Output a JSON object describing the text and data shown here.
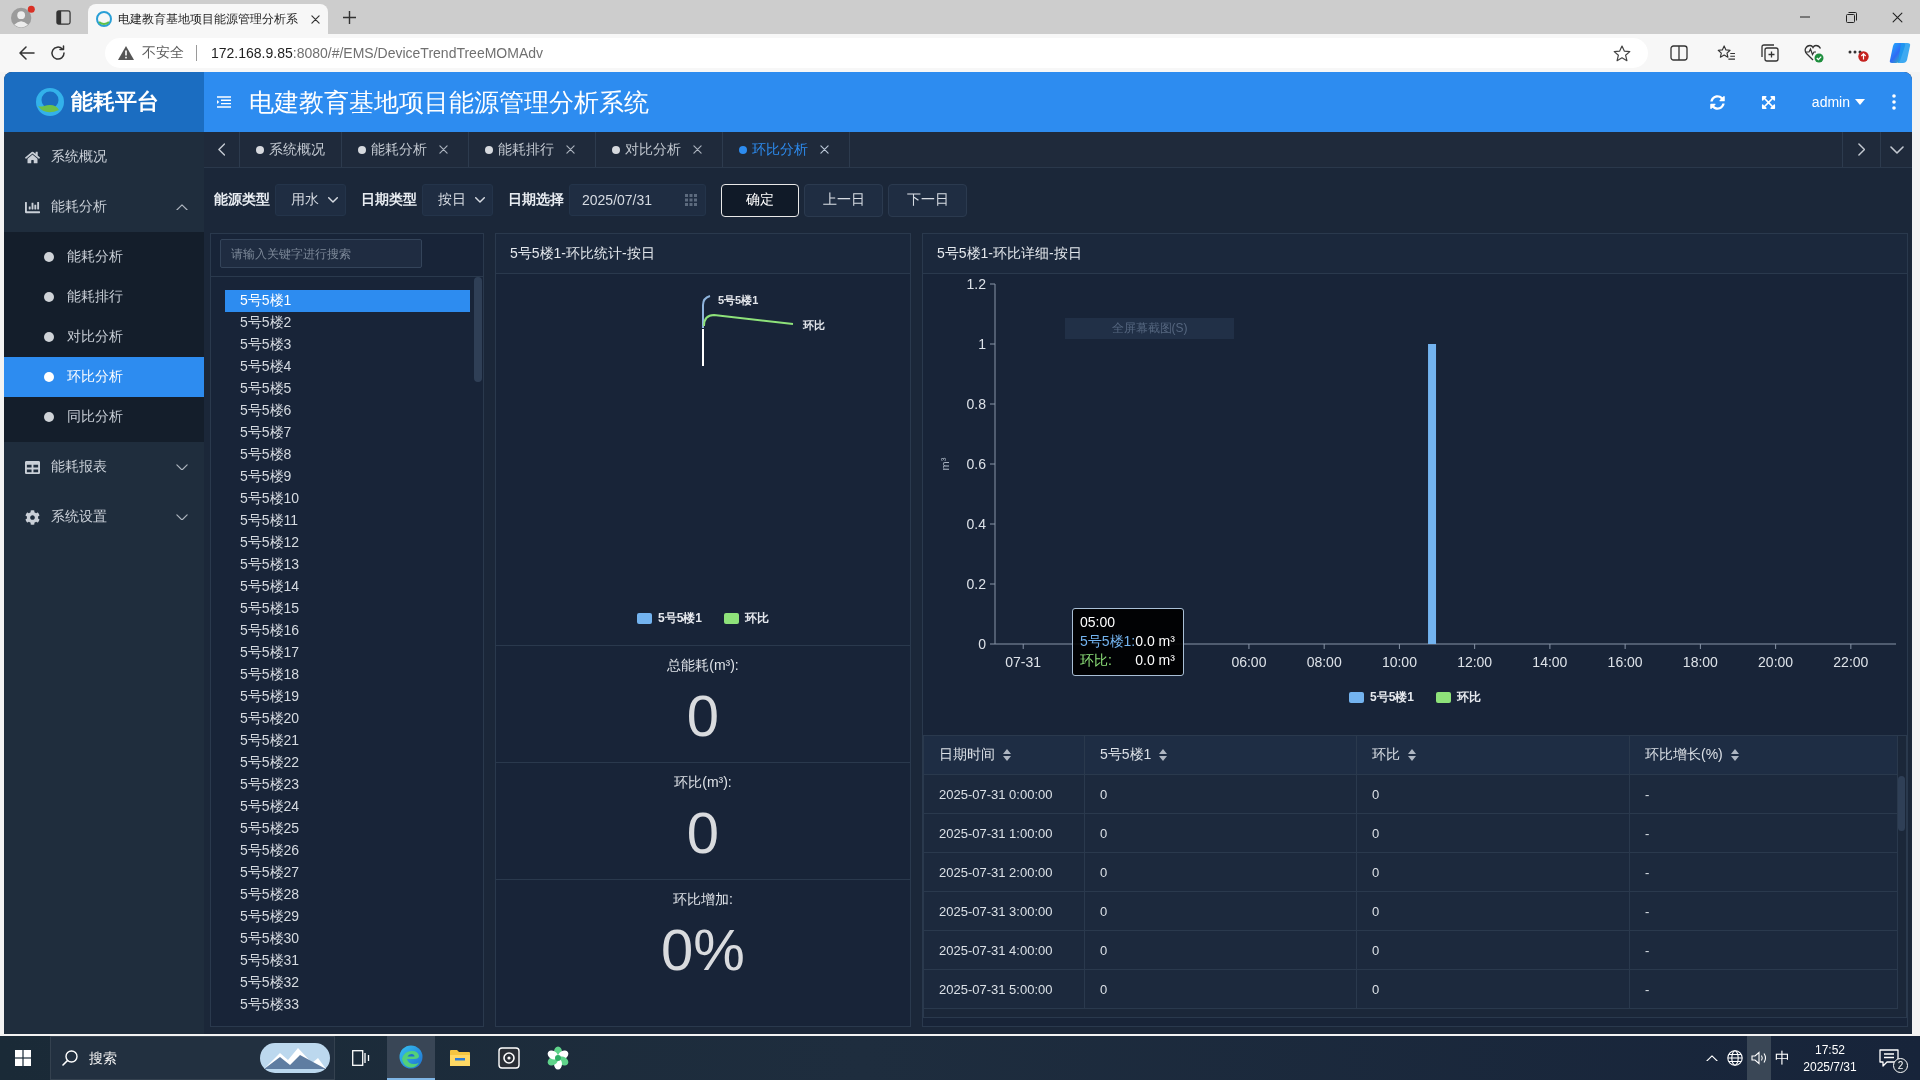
{
  "browser": {
    "tab": {
      "title": "电建教育基地项目能源管理分析系"
    },
    "address": {
      "security": "不安全",
      "host": "172.168.9.85",
      "path": ":8080/#/EMS/DeviceTrendTreeMOMAdv"
    }
  },
  "header": {
    "logo": "能耗平台",
    "title": "电建教育基地项目能源管理分析系统",
    "user": "admin"
  },
  "sidebar": {
    "items": [
      {
        "label": "系统概况",
        "kind": "link",
        "selected": false
      },
      {
        "label": "能耗分析",
        "kind": "group",
        "expanded": true,
        "children": [
          {
            "label": "能耗分析",
            "selected": false
          },
          {
            "label": "能耗排行",
            "selected": false
          },
          {
            "label": "对比分析",
            "selected": false
          },
          {
            "label": "环比分析",
            "selected": true
          },
          {
            "label": "同比分析",
            "selected": false
          }
        ]
      },
      {
        "label": "能耗报表",
        "kind": "group",
        "expanded": false
      },
      {
        "label": "系统设置",
        "kind": "group",
        "expanded": false
      }
    ]
  },
  "tabs": [
    {
      "label": "系统概况",
      "closable": false,
      "selected": false
    },
    {
      "label": "能耗分析",
      "closable": true,
      "selected": false
    },
    {
      "label": "能耗排行",
      "closable": true,
      "selected": false
    },
    {
      "label": "对比分析",
      "closable": true,
      "selected": false
    },
    {
      "label": "环比分析",
      "closable": true,
      "selected": true
    }
  ],
  "filters": [
    {
      "kind": "select",
      "label": "能源类型",
      "value": "用水"
    },
    {
      "kind": "select",
      "label": "日期类型",
      "value": "按日"
    },
    {
      "kind": "date",
      "label": "日期选择",
      "value": "2025/07/31"
    }
  ],
  "actions": [
    {
      "label": "确定",
      "kind": "primary"
    },
    {
      "label": "上一日",
      "kind": "default"
    },
    {
      "label": "下一日",
      "kind": "default"
    }
  ],
  "device_tree": {
    "search": {
      "placeholder": "请输入关键字进行搜索"
    },
    "items": [
      {
        "label": "5号5楼1",
        "selected": true
      },
      {
        "label": "5号5楼2",
        "selected": false
      },
      {
        "label": "5号5楼3",
        "selected": false
      },
      {
        "label": "5号5楼4",
        "selected": false
      },
      {
        "label": "5号5楼5",
        "selected": false
      },
      {
        "label": "5号5楼6",
        "selected": false
      },
      {
        "label": "5号5楼7",
        "selected": false
      },
      {
        "label": "5号5楼8",
        "selected": false
      },
      {
        "label": "5号5楼9",
        "selected": false
      },
      {
        "label": "5号5楼10",
        "selected": false
      },
      {
        "label": "5号5楼11",
        "selected": false
      },
      {
        "label": "5号5楼12",
        "selected": false
      },
      {
        "label": "5号5楼13",
        "selected": false
      },
      {
        "label": "5号5楼14",
        "selected": false
      },
      {
        "label": "5号5楼15",
        "selected": false
      },
      {
        "label": "5号5楼16",
        "selected": false
      },
      {
        "label": "5号5楼17",
        "selected": false
      },
      {
        "label": "5号5楼18",
        "selected": false
      },
      {
        "label": "5号5楼19",
        "selected": false
      },
      {
        "label": "5号5楼20",
        "selected": false
      },
      {
        "label": "5号5楼21",
        "selected": false
      },
      {
        "label": "5号5楼22",
        "selected": false
      },
      {
        "label": "5号5楼23",
        "selected": false
      },
      {
        "label": "5号5楼24",
        "selected": false
      },
      {
        "label": "5号5楼25",
        "selected": false
      },
      {
        "label": "5号5楼26",
        "selected": false
      },
      {
        "label": "5号5楼27",
        "selected": false
      },
      {
        "label": "5号5楼28",
        "selected": false
      },
      {
        "label": "5号5楼29",
        "selected": false
      },
      {
        "label": "5号5楼30",
        "selected": false
      },
      {
        "label": "5号5楼31",
        "selected": false
      },
      {
        "label": "5号5楼32",
        "selected": false
      },
      {
        "label": "5号5楼33",
        "selected": false
      }
    ]
  },
  "summary_panel": {
    "title": "5号5楼1-环比统计-按日",
    "pie_labels": [
      {
        "text": "5号5楼1",
        "color": "#8fb4dc"
      },
      {
        "text": "环比",
        "color": "#8ee27a"
      }
    ],
    "legend": [
      {
        "label": "5号5楼1",
        "color": "#73b3ef"
      },
      {
        "label": "环比",
        "color": "#8ee27a"
      }
    ],
    "stats": [
      {
        "label": "总能耗(m³):",
        "value": "0"
      },
      {
        "label": "环比(m³):",
        "value": "0"
      },
      {
        "label": "环比增加:",
        "value": "0%"
      }
    ]
  },
  "detail_panel": {
    "title": "5号5楼1-环比详细-按日",
    "screen_tip": "全屏幕截图(S)",
    "chart_data": {
      "type": "bar",
      "ylabel": "m³",
      "x": [
        11
      ],
      "series": [
        {
          "name": "5号5楼1",
          "color": "#73b3ef",
          "values": [
            1
          ]
        },
        {
          "name": "环比",
          "color": "#8ee27a",
          "values": [
            0
          ]
        }
      ],
      "xlim": [
        -0.75,
        23.2
      ],
      "ylim": [
        0,
        1.2
      ],
      "yticks": [
        0,
        0.2,
        0.4,
        0.6,
        0.8,
        1,
        1.2
      ],
      "xticks": [
        {
          "value": 0,
          "label": "07-31"
        },
        {
          "value": 6,
          "label": "06:00"
        },
        {
          "value": 8,
          "label": "08:00"
        },
        {
          "value": 10,
          "label": "10:00"
        },
        {
          "value": 12,
          "label": "12:00"
        },
        {
          "value": 14,
          "label": "14:00"
        },
        {
          "value": 16,
          "label": "16:00"
        },
        {
          "value": 18,
          "label": "18:00"
        },
        {
          "value": 20,
          "label": "20:00"
        },
        {
          "value": 22,
          "label": "22:00"
        }
      ]
    },
    "tooltip": {
      "title": "05:00",
      "rows": [
        {
          "label": "5号5楼1:",
          "value": "0.0 m³",
          "color": "#73b3ef"
        },
        {
          "label": "环比:",
          "value": "0.0 m³",
          "color": "#8ee27a"
        }
      ]
    },
    "table": {
      "columns": [
        "日期时间",
        "5号5楼1",
        "环比",
        "环比增长(%)"
      ],
      "rows": [
        [
          "2025-07-31 0:00:00",
          "0",
          "0",
          "-"
        ],
        [
          "2025-07-31 1:00:00",
          "0",
          "0",
          "-"
        ],
        [
          "2025-07-31 2:00:00",
          "0",
          "0",
          "-"
        ],
        [
          "2025-07-31 3:00:00",
          "0",
          "0",
          "-"
        ],
        [
          "2025-07-31 4:00:00",
          "0",
          "0",
          "-"
        ],
        [
          "2025-07-31 5:00:00",
          "0",
          "0",
          "-"
        ]
      ]
    }
  },
  "taskbar": {
    "search": {
      "placeholder": "搜索"
    },
    "ime": "中",
    "time": "17:52",
    "date": "2025/7/31",
    "notifications": "2"
  }
}
